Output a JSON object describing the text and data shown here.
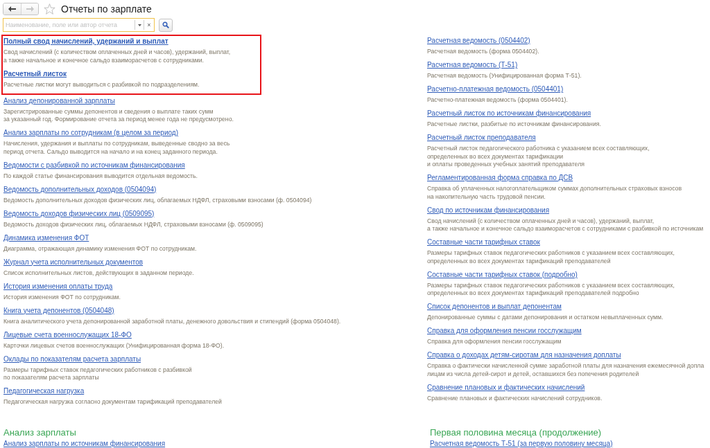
{
  "toolbar": {
    "nav_buttons": [
      {
        "kind": "back",
        "disabled": false
      },
      {
        "kind": "forward",
        "disabled": true
      }
    ],
    "favorite": false,
    "title": "Отчеты по зарплате"
  },
  "search": {
    "placeholder": "Наименование, поле или автор отчета",
    "clear": "×"
  },
  "columns": [
    {
      "highlighted_reports": [
        {
          "title": "Полный свод начислений, удержаний и выплат",
          "bold": true,
          "description": [
            "Свод начислений (с количеством оплаченных дней и часов), удержаний, выплат,",
            "а также начальное и конечное сальдо взаиморасчетов с сотрудниками."
          ]
        },
        {
          "title": "Расчетный листок",
          "bold": true,
          "description": [
            "Расчетные листки могут выводиться с разбивкой по подразделениям."
          ]
        }
      ],
      "reports": [
        {
          "title": "Анализ депонированной зарплаты",
          "bold": false,
          "description": [
            "Зарегистрированные суммы депонентов и сведения о выплате таких сумм",
            "за указанный год. Формирование отчета за период менее года не предусмотрено."
          ]
        },
        {
          "title": "Анализ зарплаты по сотрудникам (в целом за период)",
          "bold": false,
          "description": [
            "Начисления, удержания и выплаты по сотрудникам, выведенные сводно за весь",
            "период отчета. Сальдо выводится на начало и на конец заданного периода."
          ]
        },
        {
          "title": "Ведомости с разбивкой по источникам финансирования",
          "bold": false,
          "description": [
            "По каждой статье финансирования выводится отдельная ведомость."
          ]
        },
        {
          "title": "Ведомость дополнительных доходов (0504094)",
          "bold": false,
          "description": [
            "Ведомость дополнительных доходов физических лиц, облагаемых НДФЛ, страховыми взносами (ф. 0504094)"
          ]
        },
        {
          "title": "Ведомость доходов физических лиц (0509095)",
          "bold": false,
          "description": [
            "Ведомость доходов физических лиц, облагаемых НДФЛ, страховыми взносами (ф. 0509095)"
          ]
        },
        {
          "title": "Динамика изменения ФОТ",
          "bold": false,
          "description": [
            "Диаграмма, отражающая динамику изменения ФОТ по сотрудникам."
          ]
        },
        {
          "title": "Журнал учета исполнительных документов",
          "bold": false,
          "description": [
            "Список исполнительных листов, действующих в заданном периоде."
          ]
        },
        {
          "title": "История изменения оплаты труда",
          "bold": false,
          "description": [
            "История изменения ФОТ по сотрудникам."
          ]
        },
        {
          "title": "Книга учета депонентов (0504048)",
          "bold": false,
          "description": [
            "Книга аналитического учета депонированной заработной платы, денежного довольствия и стипендий (форма 0504048)."
          ]
        },
        {
          "title": "Лицевые счета военнослужащих 18-ФО",
          "bold": false,
          "description": [
            "Карточки лицевых счетов военнослужащих (Унифицированная форма 18-ФО)."
          ]
        },
        {
          "title": "Оклады по показателям расчета зарплаты",
          "bold": false,
          "description": [
            "Размеры тарифных ставок педагогических работников с разбивкой",
            "по показателям расчета зарплаты"
          ]
        },
        {
          "title": "Педагогическая нагрузка",
          "bold": false,
          "description": [
            "Педагогическая нагрузка согласно документам тарификаций преподавателей"
          ]
        }
      ]
    },
    {
      "reports": [
        {
          "title": "Расчетная ведомость (0504402)",
          "bold": false,
          "description": [
            "Расчетная ведомость (форма 0504402)."
          ]
        },
        {
          "title": "Расчетная ведомость (Т-51)",
          "bold": false,
          "description": [
            "Расчетная ведомость (Унифицированная форма Т-51)."
          ]
        },
        {
          "title": "Расчетно-платежная ведомость (0504401)",
          "bold": false,
          "description": [
            "Расчетно-платежная ведомость (форма 0504401)."
          ]
        },
        {
          "title": "Расчетный листок по источникам финансирования",
          "bold": false,
          "description": [
            "Расчетные листки, разбитые по источникам финансирования."
          ]
        },
        {
          "title": "Расчетный листок преподавателя",
          "bold": false,
          "description": [
            "Расчетный листок педагогического работника с указанием всех составляющих,",
            "определенных во всех документах тарификации",
            "и оплаты проведенных учебных занятий преподавателя"
          ]
        },
        {
          "title": "Регламентированная форма справка по ДСВ",
          "bold": false,
          "description": [
            "Справка об уплаченных налогоплательщиком суммах дополнительных страховых взносов",
            "на накопительную часть трудовой пенсии."
          ]
        },
        {
          "title": "Свод по источникам финансирования",
          "bold": false,
          "description": [
            "Свод начислений (с количеством оплаченных дней и часов), удержаний, выплат,",
            "а также начальное и конечное сальдо взаиморасчетов с сотрудниками с разбивкой по источникам"
          ]
        },
        {
          "title": "Составные части тарифных ставок",
          "bold": false,
          "description": [
            "Размеры тарифных ставок педагогических работников с указанием всех составляющих,",
            "определенных во всех документах тарификаций преподавателей"
          ]
        },
        {
          "title": "Составные части тарифных ставок (подробно)",
          "bold": false,
          "description": [
            "Размеры тарифных ставок педагогических работников с указанием всех составляющих,",
            "определенных во всех документах тарификаций преподавателей подробно"
          ]
        },
        {
          "title": "Список депонентов и выплат депонентам",
          "bold": false,
          "description": [
            "Депонированные суммы с датами депонирования и остатком невыплаченных сумм."
          ]
        },
        {
          "title": "Справка для оформления пенсии госслужащим",
          "bold": false,
          "description": [
            "Справка для оформления пенсии госслужащим"
          ]
        },
        {
          "title": "Справка о доходах детям-сиротам для назначения доплаты",
          "bold": false,
          "description": [
            "Справка о фактически начисленной сумме заработной платы для назначения ежемесячной допла",
            "лицам из числа детей-сирот и детей, оставшихся без попечения родителей"
          ]
        },
        {
          "title": "Сравнение плановых и фактических начислений",
          "bold": false,
          "description": [
            "Сравнение плановых и фактических начислений сотрудников."
          ]
        }
      ]
    }
  ],
  "sections": [
    {
      "heading": "Анализ зарплаты",
      "reports": [
        {
          "title": "Анализ зарплаты по источникам финансирования"
        }
      ]
    },
    {
      "heading": "Первая половина месяца (продолжение)",
      "reports": [
        {
          "title": "Расчетная ведомость Т-51 (за первую половину месяца)"
        }
      ]
    }
  ]
}
